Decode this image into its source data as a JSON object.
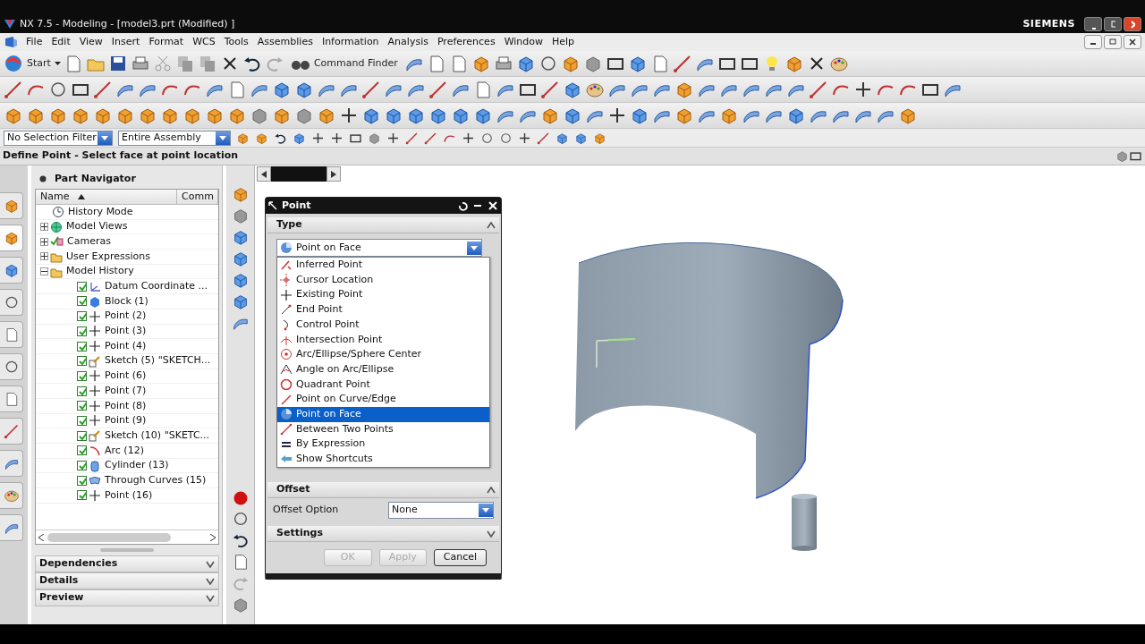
{
  "window": {
    "title": "NX 7.5 - Modeling - [model3.prt (Modified) ]",
    "brand": "SIEMENS"
  },
  "menu": [
    "File",
    "Edit",
    "View",
    "Insert",
    "Format",
    "WCS",
    "Tools",
    "Assemblies",
    "Information",
    "Analysis",
    "Preferences",
    "Window",
    "Help"
  ],
  "toolbar": {
    "start": "Start",
    "command_finder": "Command Finder"
  },
  "selection_bar": {
    "filter": "No Selection Filter",
    "scope": "Entire Assembly"
  },
  "cue_line": "Define Point - Select face at point location",
  "navigator": {
    "title": "Part Navigator",
    "columns": [
      "Name",
      "Comm"
    ],
    "nodes": [
      {
        "label": "History Mode",
        "kind": "history"
      },
      {
        "label": "Model Views",
        "kind": "views",
        "expanded": false
      },
      {
        "label": "Cameras",
        "kind": "cameras",
        "expanded": false
      },
      {
        "label": "User Expressions",
        "kind": "folder",
        "expanded": false
      },
      {
        "label": "Model History",
        "kind": "folder",
        "expanded": true,
        "children": [
          {
            "label": "Datum Coordinate ...",
            "kind": "datum",
            "checked": true
          },
          {
            "label": "Block (1)",
            "kind": "block",
            "checked": true
          },
          {
            "label": "Point (2)",
            "kind": "point",
            "checked": true
          },
          {
            "label": "Point (3)",
            "kind": "point",
            "checked": true
          },
          {
            "label": "Point (4)",
            "kind": "point",
            "checked": true
          },
          {
            "label": "Sketch (5) \"SKETCH...",
            "kind": "sketch",
            "checked": true
          },
          {
            "label": "Point (6)",
            "kind": "point",
            "checked": true
          },
          {
            "label": "Point (7)",
            "kind": "point",
            "checked": true
          },
          {
            "label": "Point (8)",
            "kind": "point",
            "checked": true
          },
          {
            "label": "Point (9)",
            "kind": "point",
            "checked": true
          },
          {
            "label": "Sketch (10) \"SKETC...",
            "kind": "sketch",
            "checked": true
          },
          {
            "label": "Arc (12)",
            "kind": "arc",
            "checked": true
          },
          {
            "label": "Cylinder (13)",
            "kind": "cylinder",
            "checked": true
          },
          {
            "label": "Through Curves (15)",
            "kind": "surface",
            "checked": true
          },
          {
            "label": "Point (16)",
            "kind": "point",
            "checked": true
          }
        ]
      }
    ],
    "panels": [
      {
        "label": "Dependencies",
        "expanded": false
      },
      {
        "label": "Details",
        "expanded": false
      },
      {
        "label": "Preview",
        "expanded": false
      }
    ]
  },
  "dialog": {
    "title": "Point",
    "type_section": {
      "label": "Type",
      "expanded": true
    },
    "type_value": "Point on Face",
    "type_options": [
      {
        "label": "Inferred Point",
        "selected": false
      },
      {
        "label": "Cursor Location",
        "selected": false
      },
      {
        "label": "Existing Point",
        "selected": false
      },
      {
        "label": "End Point",
        "selected": false
      },
      {
        "label": "Control Point",
        "selected": false
      },
      {
        "label": "Intersection Point",
        "selected": false
      },
      {
        "label": "Arc/Ellipse/Sphere Center",
        "selected": false
      },
      {
        "label": "Angle on Arc/Ellipse",
        "selected": false
      },
      {
        "label": "Quadrant Point",
        "selected": false
      },
      {
        "label": "Point on Curve/Edge",
        "selected": false
      },
      {
        "label": "Point on Face",
        "selected": true
      },
      {
        "label": "Between Two Points",
        "selected": false
      },
      {
        "label": "By Expression",
        "selected": false
      },
      {
        "label": "Show Shortcuts",
        "selected": false
      }
    ],
    "offset_section": {
      "label": "Offset",
      "expanded": true
    },
    "offset_option": {
      "label": "Offset Option",
      "value": "None"
    },
    "settings_section": {
      "label": "Settings",
      "expanded": false
    },
    "buttons": [
      {
        "label": "OK",
        "disabled": true
      },
      {
        "label": "Apply",
        "disabled": true
      },
      {
        "label": "Cancel",
        "disabled": false
      }
    ]
  }
}
